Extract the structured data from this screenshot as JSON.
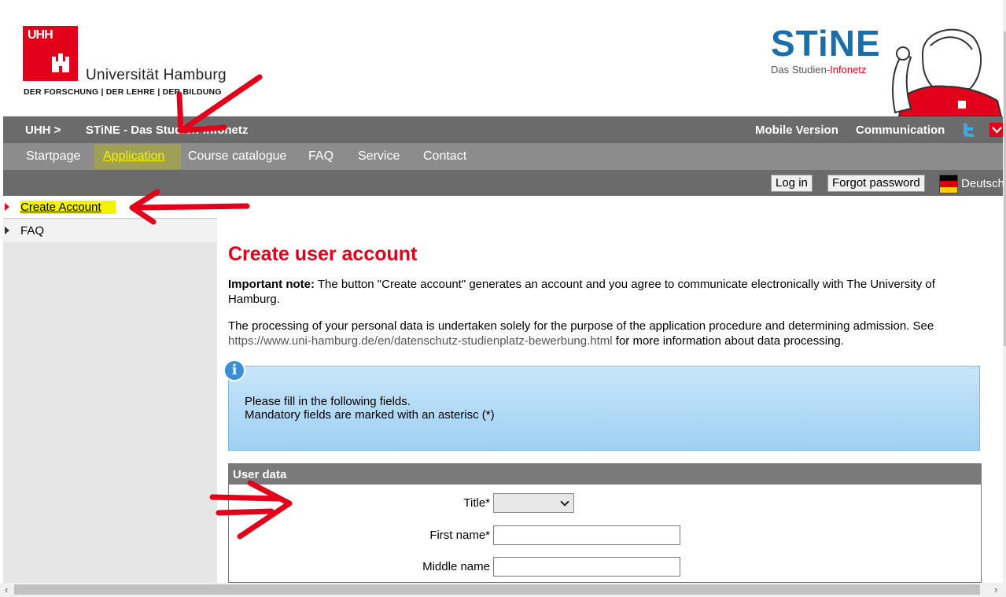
{
  "header": {
    "uni_logo_letters": "UHH",
    "uni_name": "Universität Hamburg",
    "uni_claim": "DER FORSCHUNG | DER LEHRE | DER BILDUNG",
    "stine_wordmark": "STiNE",
    "stine_sub_a": "Das Studien-",
    "stine_sub_b": "Infonetz"
  },
  "topbar": {
    "crumb_1": "UHH >",
    "crumb_2": "STiNE - Das Studien-Infonetz",
    "mobile": "Mobile Version",
    "communication": "Communication"
  },
  "nav": {
    "items": [
      "Startpage",
      "Application",
      "Course catalogue",
      "FAQ",
      "Service",
      "Contact"
    ],
    "active": "Application"
  },
  "login": {
    "login_label": "Log in",
    "forgot_label": "Forgot password",
    "language": "Deutsch"
  },
  "sidebar": {
    "items": [
      {
        "label": "Create Account",
        "active": true
      },
      {
        "label": "FAQ",
        "active": false
      }
    ]
  },
  "content": {
    "title": "Create user account",
    "note_bold": "Important note:",
    "note_text": " The button \"Create account\" generates an account and you agree to communicate electronically with The University of Hamburg.",
    "privacy_text": "The processing of your personal data is undertaken solely for the purpose of the application procedure and determining admission. See ",
    "privacy_link": "https://www.uni-hamburg.de/en/datenschutz-studienplatz-bewerbung.html",
    "privacy_tail": " for more information about data processing.",
    "info_line1": "Please fill in the following fields.",
    "info_line2": "Mandatory fields are marked with an asterisc (*)",
    "panel_title": "User data",
    "fields": [
      {
        "label": "Title*",
        "type": "select",
        "value": ""
      },
      {
        "label": "First name*",
        "type": "text",
        "value": ""
      },
      {
        "label": "Middle name",
        "type": "text",
        "value": ""
      }
    ]
  },
  "colors": {
    "uhh_red": "#e2001a",
    "bar_dark": "#6b6b6b",
    "bar_mid": "#8c8c8c",
    "highlight_yellow": "#f3f300"
  }
}
